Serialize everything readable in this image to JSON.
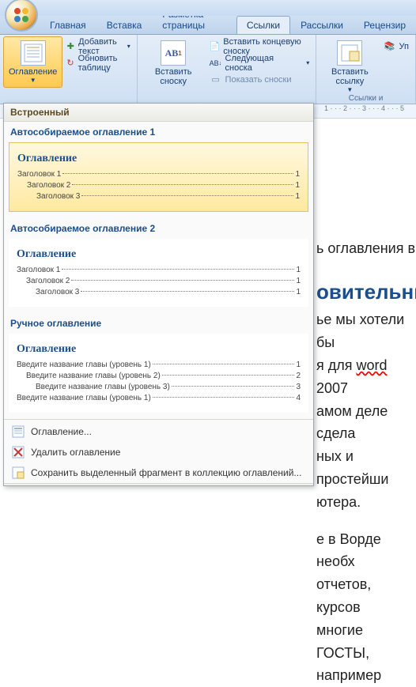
{
  "titlebar": {},
  "tabs": {
    "items": [
      "Главная",
      "Вставка",
      "Разметка страницы",
      "Ссылки",
      "Рассылки",
      "Рецензир"
    ],
    "active_index": 3
  },
  "ribbon": {
    "toc_button": "Оглавление",
    "add_text": "Добавить текст",
    "update_table": "Обновить таблицу",
    "insert_footnote": "Вставить сноску",
    "insert_endnote": "Вставить концевую сноску",
    "next_footnote": "Следующая сноска",
    "show_footnotes": "Показать сноски",
    "insert_link": "Вставить ссылку",
    "manage": "Уп",
    "links_group": "Ссылки и"
  },
  "gallery": {
    "header": "Встроенный",
    "auto1": {
      "section_title": "Автособираемое оглавление 1",
      "toc_title": "Оглавление",
      "lines": [
        {
          "txt": "Заголовок 1",
          "pg": "1",
          "lvl": 1
        },
        {
          "txt": "Заголовок 2",
          "pg": "1",
          "lvl": 2
        },
        {
          "txt": "Заголовок 3",
          "pg": "1",
          "lvl": 3
        }
      ]
    },
    "auto2": {
      "section_title": "Автособираемое оглавление 2",
      "toc_title": "Оглавление",
      "lines": [
        {
          "txt": "Заголовок 1",
          "pg": "1",
          "lvl": 1
        },
        {
          "txt": "Заголовок 2",
          "pg": "1",
          "lvl": 2
        },
        {
          "txt": "Заголовок 3",
          "pg": "1",
          "lvl": 3
        }
      ]
    },
    "manual": {
      "section_title": "Ручное оглавление",
      "toc_title": "Оглавление",
      "lines": [
        {
          "txt": "Введите название главы (уровень 1)",
          "pg": "1",
          "lvl": 1
        },
        {
          "txt": "Введите название главы (уровень 2)",
          "pg": "2",
          "lvl": 2
        },
        {
          "txt": "Введите название главы (уровень 3)",
          "pg": "3",
          "lvl": 3
        },
        {
          "txt": "Введите название главы (уровень 1)",
          "pg": "4",
          "lvl": 1
        }
      ]
    },
    "cmd_toc": "Оглавление...",
    "cmd_remove": "Удалить оглавление",
    "cmd_save": "Сохранить выделенный фрагмент в коллекцию оглавлений..."
  },
  "doc": {
    "ruler_marks": "1 · · · 2 · · · 3 · · · 4 · · · 5",
    "frag1": "ь оглавления в ",
    "frag2": "овительный",
    "frag3": "ье мы хотели бы",
    "frag4_a": "я для ",
    "frag4_b": "word",
    "frag4_c": " 2007",
    "frag5": "амом деле сдела",
    "frag6": "ных и простейши",
    "frag7": "ютера.",
    "frag8": "е в Ворде необх",
    "frag9": "отчетов, курсов",
    "frag10": "многие ГОСТЫ, например"
  }
}
